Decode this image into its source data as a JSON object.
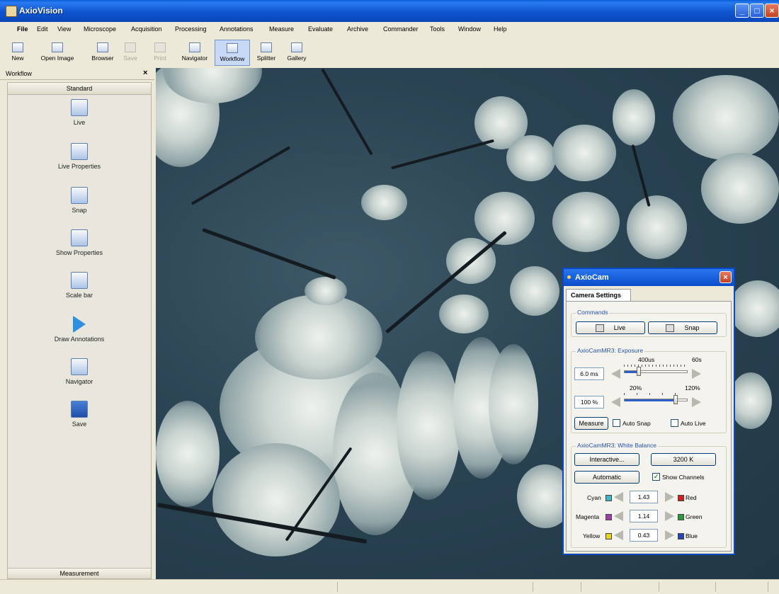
{
  "window": {
    "title": "AxioVision"
  },
  "menu": [
    "File",
    "Edit",
    "View",
    "Microscope",
    "Acquisition",
    "Processing",
    "Annotations",
    "Measure",
    "Evaluate",
    "Archive",
    "Commander",
    "Tools",
    "Window",
    "Help"
  ],
  "toolbar": {
    "new": "New",
    "open_image": "Open Image",
    "browser": "Browser",
    "save": "Save",
    "print": "Print",
    "navigator": "Navigator",
    "workflow": "Workflow",
    "splitter": "Splitter",
    "gallery": "Gallery"
  },
  "workflow_panel": {
    "title": "Workflow",
    "close": "×",
    "group": "Standard",
    "items": [
      "Live",
      "Live Properties",
      "Snap",
      "Show Properties",
      "Scale bar",
      "Draw Annotations",
      "Navigator",
      "Save"
    ],
    "footer": "Measurement"
  },
  "axiocam": {
    "title": "AxioCam",
    "close": "×",
    "tab": "Camera Settings",
    "commands": {
      "label": "Commands",
      "live": "Live",
      "snap": "Snap"
    },
    "exposure": {
      "label": "AxioCamMR3: Exposure",
      "time_value": "6.0 ms",
      "time_min": "400us",
      "time_max": "60s",
      "gain_value": "100 %",
      "gain_min": "20%",
      "gain_max": "120%",
      "measure": "Measure",
      "auto_snap": "Auto Snap",
      "auto_live": "Auto Live",
      "auto_snap_checked": false,
      "auto_live_checked": false
    },
    "white_balance": {
      "label": "AxioCamMR3: White Balance",
      "interactive": "Interactive...",
      "temp": "3200 K",
      "automatic": "Automatic",
      "show_channels": "Show Channels",
      "show_channels_checked": true,
      "check_mark": "✓",
      "channels": [
        {
          "left": "Cyan",
          "value": "1.43",
          "right": "Red",
          "left_color": "#3fb6c6",
          "right_color": "#d0201e"
        },
        {
          "left": "Magenta",
          "value": "1.14",
          "right": "Green",
          "left_color": "#a13fa8",
          "right_color": "#2d9a3a"
        },
        {
          "left": "Yellow",
          "value": "0.43",
          "right": "Blue",
          "left_color": "#e8d21a",
          "right_color": "#2544b8"
        }
      ]
    }
  }
}
